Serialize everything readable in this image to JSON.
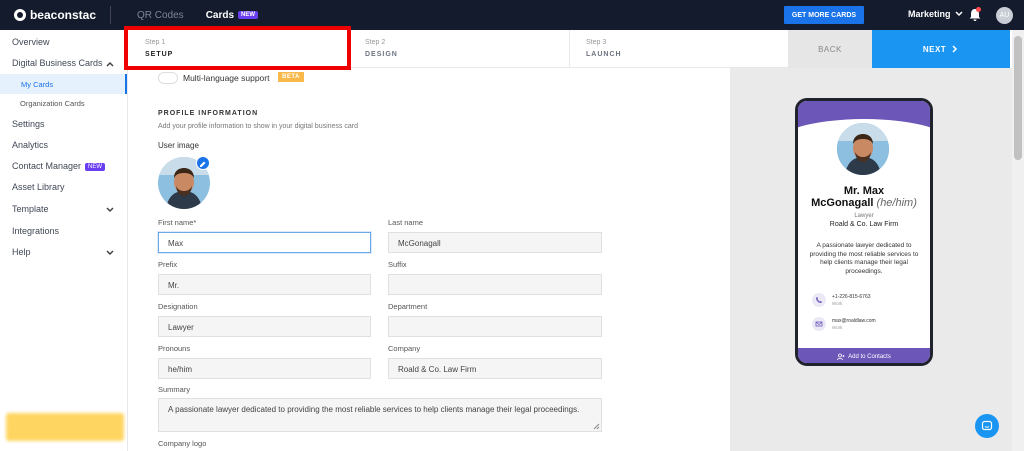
{
  "topbar": {
    "logo_text": "beaconstac",
    "nav_qr": "QR Codes",
    "nav_cards": "Cards",
    "cards_badge": "NEW",
    "get_more_label": "GET MORE CARDS",
    "workspace_label": "Marketing",
    "avatar_initials": "AU"
  },
  "sidebar": {
    "items": [
      {
        "label": "Overview"
      },
      {
        "label": "Digital Business Cards"
      },
      {
        "label": "My Cards"
      },
      {
        "label": "Organization Cards"
      },
      {
        "label": "Settings"
      },
      {
        "label": "Analytics"
      },
      {
        "label": "Contact Manager"
      },
      {
        "label": "Asset Library"
      },
      {
        "label": "Template"
      },
      {
        "label": "Integrations"
      },
      {
        "label": "Help"
      }
    ],
    "contact_badge": "NEW"
  },
  "steps": [
    {
      "num": "Step 1",
      "label": "SETUP"
    },
    {
      "num": "Step 2",
      "label": "DESIGN"
    },
    {
      "num": "Step 3",
      "label": "LAUNCH"
    }
  ],
  "actions": {
    "back": "BACK",
    "next": "NEXT"
  },
  "form": {
    "multilang_label": "Multi-language support",
    "beta_badge": "BETA",
    "section_title": "PROFILE INFORMATION",
    "section_sub": "Add your profile information to show in your digital business card",
    "user_image_label": "User image",
    "first_name_label": "First name*",
    "first_name_value": "Max",
    "last_name_label": "Last name",
    "last_name_value": "McGonagall",
    "prefix_label": "Prefix",
    "prefix_value": "Mr.",
    "suffix_label": "Suffix",
    "suffix_value": "",
    "designation_label": "Designation",
    "designation_value": "Lawyer",
    "department_label": "Department",
    "department_value": "",
    "pronouns_label": "Pronouns",
    "pronouns_value": "he/him",
    "company_label": "Company",
    "company_value": "Roald & Co. Law Firm",
    "summary_label": "Summary",
    "summary_value": "A passionate lawyer dedicated to providing the most reliable services to help clients manage their legal proceedings.",
    "company_logo_label": "Company logo"
  },
  "preview": {
    "name_line1": "Mr. Max",
    "name_line2": "McGonagall",
    "pronouns": "(he/him)",
    "designation": "Lawyer",
    "company": "Roald & Co. Law Firm",
    "summary": "A passionate lawyer dedicated to providing the most reliable services to help clients manage their legal proceedings.",
    "contacts": [
      {
        "value": "+1-226-815-6763",
        "type": "Work"
      },
      {
        "value": "max@roaldlaw.com",
        "type": "Work"
      }
    ],
    "add_contacts_label": "Add to Contacts"
  },
  "colors": {
    "accent": "#1a95f2",
    "card_purple": "#6c57b8",
    "highlight": "#ee0000"
  }
}
